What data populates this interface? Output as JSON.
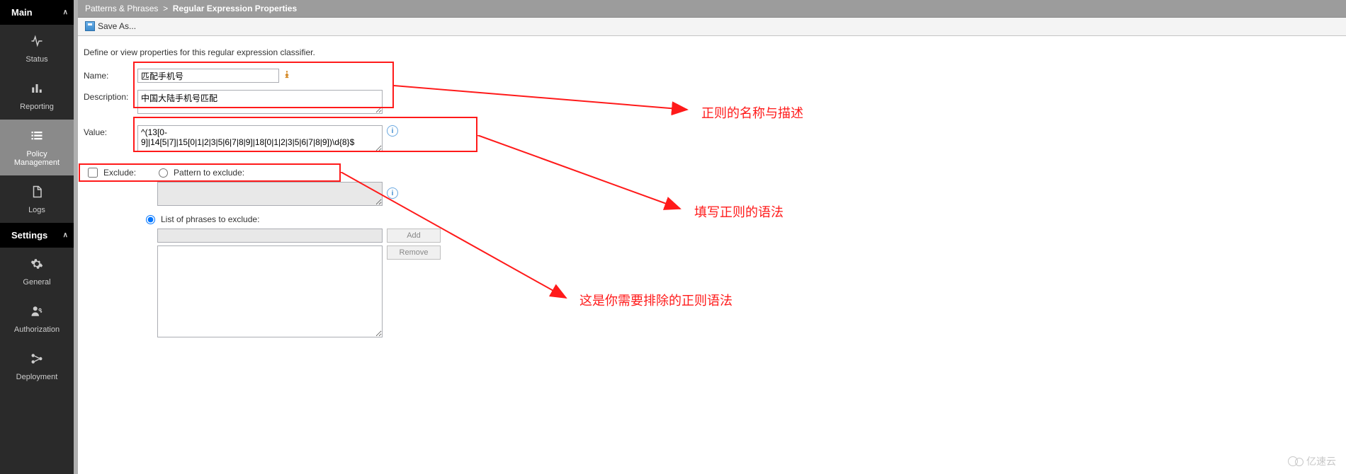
{
  "sidebar": {
    "main_label": "Main",
    "settings_label": "Settings",
    "items": [
      {
        "label": "Status",
        "icon": "pulse"
      },
      {
        "label": "Reporting",
        "icon": "bar"
      },
      {
        "label": "Policy Management",
        "icon": "list"
      },
      {
        "label": "Logs",
        "icon": "doc"
      }
    ],
    "settings_items": [
      {
        "label": "General",
        "icon": "gear"
      },
      {
        "label": "Authorization",
        "icon": "person"
      },
      {
        "label": "Deployment",
        "icon": "deploy"
      }
    ]
  },
  "breadcrumb": {
    "parent": "Patterns & Phrases",
    "sep": ">",
    "current": "Regular Expression Properties"
  },
  "toolbar": {
    "save_as": "Save As..."
  },
  "content": {
    "intro": "Define or view properties for this regular expression classifier.",
    "name_label": "Name:",
    "name_value": "匹配手机号",
    "desc_label": "Description:",
    "desc_value": "中国大陆手机号匹配",
    "value_label": "Value:",
    "value_value": "^(13[0-9]|14[5|7]|15[0|1|2|3|5|6|7|8|9]|18[0|1|2|3|5|6|7|8|9])\\d{8}$",
    "exclude_label": "Exclude:",
    "pattern_exclude_label": "Pattern to exclude:",
    "phrases_exclude_label": "List of phrases to exclude:",
    "add_btn": "Add",
    "remove_btn": "Remove"
  },
  "annotations": {
    "a1": "正则的名称与描述",
    "a2": "填写正则的语法",
    "a3": "这是你需要排除的正则语法"
  },
  "watermark": "亿速云"
}
